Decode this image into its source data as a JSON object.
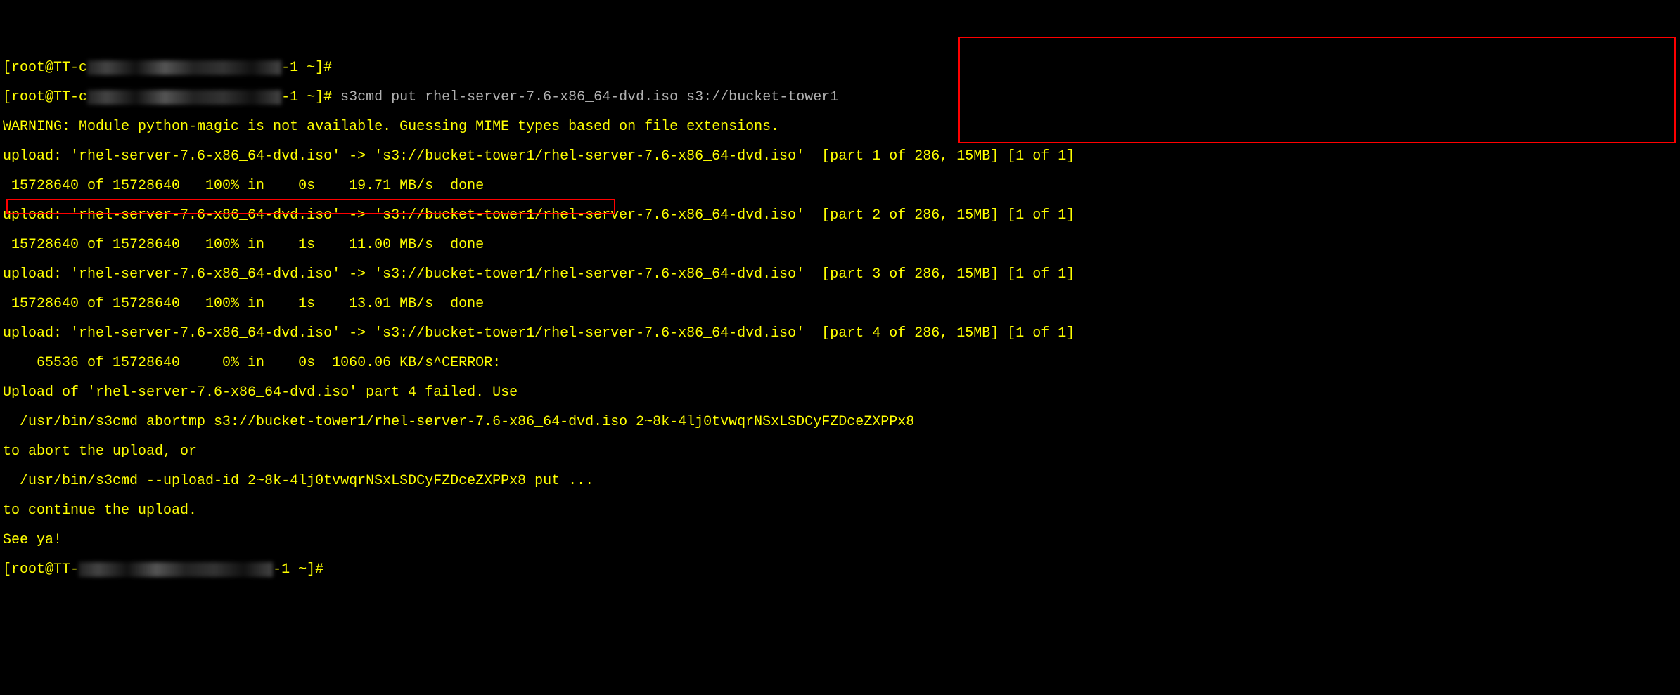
{
  "prompt_prefix": "[root@TT-c",
  "prompt_blur": "xxxxxxxxxxxxxxxxxxxxxxx",
  "prompt_suffix": "-1 ~]#",
  "command": " s3cmd put rhel-server-7.6-x86_64-dvd.iso s3://bucket-tower1",
  "warning": "WARNING: Module python-magic is not available. Guessing MIME types based on file extensions.",
  "upload_line_prefix": "upload: 'rhel-server-7.6-x86_64-dvd.iso' -> 's3://bucket-tower1/rhel-server-7.6-x86_64-dvd.iso'  ",
  "parts": {
    "p1": "[part 1 of 286, 15MB] [1 of 1]",
    "p2": "[part 2 of 286, 15MB] [1 of 1]",
    "p3": "[part 3 of 286, 15MB] [1 of 1]",
    "p4": "[part 4 of 286, 15MB] [1 of 1]"
  },
  "progress": {
    "p1": " 15728640 of 15728640   100% in    0s    19.71 MB/s  done",
    "p2": " 15728640 of 15728640   100% in    1s    11.00 MB/s  done",
    "p3": " 15728640 of 15728640   100% in    1s    13.01 MB/s  done",
    "p4": "    65536 of 15728640     0% in    0s  1060.06 KB/s^CERROR: "
  },
  "err1": "Upload of 'rhel-server-7.6-x86_64-dvd.iso' part 4 failed. Use",
  "err2": "  /usr/bin/s3cmd abortmp s3://bucket-tower1/rhel-server-7.6-x86_64-dvd.iso 2~8k-4lj0tvwqrNSxLSDCyFZDceZXPPx8",
  "err3": "to abort the upload, or",
  "err4": "  /usr/bin/s3cmd --upload-id 2~8k-4lj0tvwqrNSxLSDCyFZDceZXPPx8 put ...",
  "err5": "to continue the upload.",
  "seeya": "See ya!",
  "prompt2_prefix": "[root@TT-",
  "prompt2_blur": "xxxxxxxxxxxxxxxxxxxxxxx",
  "prompt2_suffix": "-1 ~]#",
  "top_prefix": "[root@TT-c",
  "top_blur": "xxxxxxxxxxxxxxxxxxxxxxx",
  "top_suffix": "-1 ~]#"
}
